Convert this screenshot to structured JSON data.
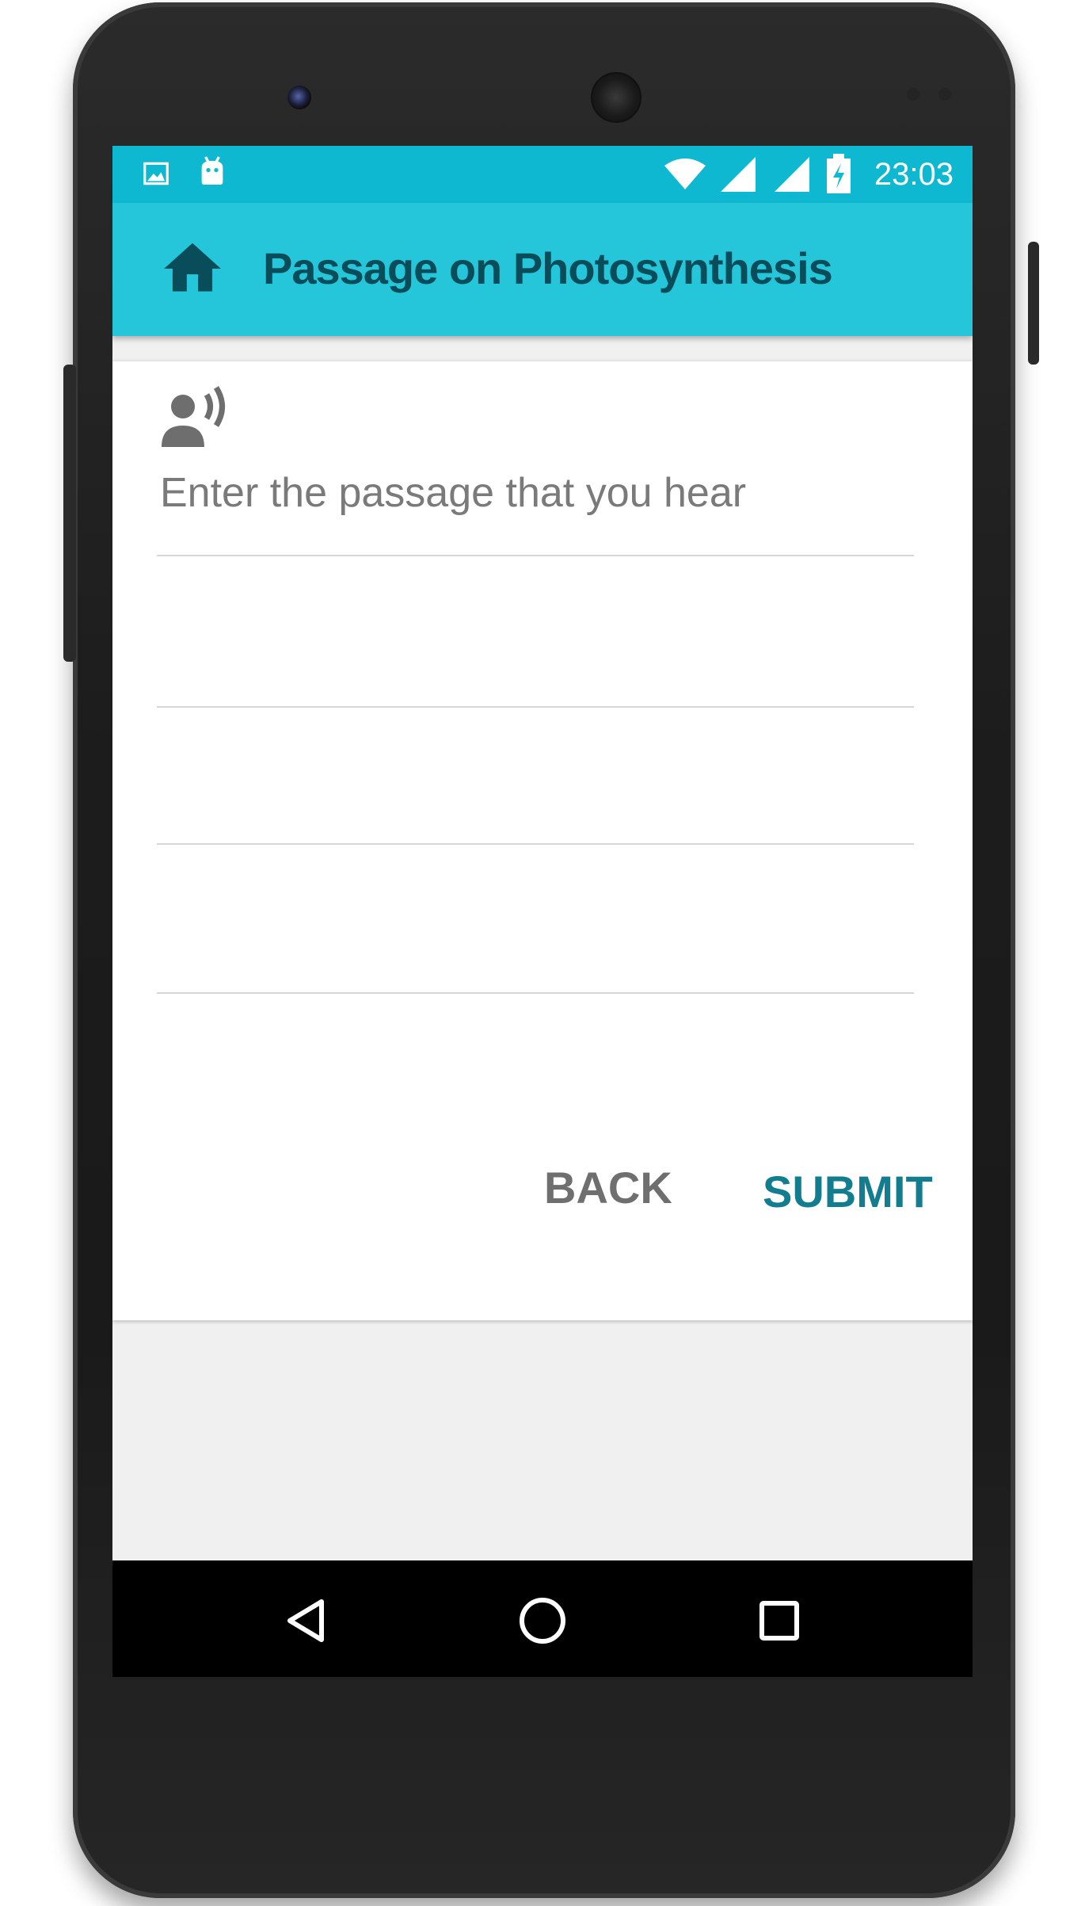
{
  "status_bar": {
    "time": "23:03",
    "left_icons": [
      "image-notification-icon",
      "android-notification-icon"
    ],
    "right_icons": [
      "wifi-icon",
      "signal-icon",
      "signal-icon",
      "battery-charging-icon"
    ]
  },
  "app_bar": {
    "title": "Passage on Photosynthesis",
    "home_icon": "home-icon"
  },
  "form": {
    "voice_icon": "record-voice-icon",
    "passage_placeholder": "Enter the passage that you hear",
    "passage_value": ""
  },
  "actions": {
    "back_label": "BACK",
    "submit_label": "SUBMIT"
  },
  "nav_bar": {
    "icons": [
      "back-triangle-icon",
      "home-circle-icon",
      "recents-square-icon"
    ]
  },
  "colors": {
    "status_bar": "#0fb8d1",
    "app_bar": "#26c6da",
    "title_text": "#0a4d5a",
    "submit_text": "#117d8f",
    "back_text": "#6f6f6f",
    "background": "#f0f0f0"
  }
}
